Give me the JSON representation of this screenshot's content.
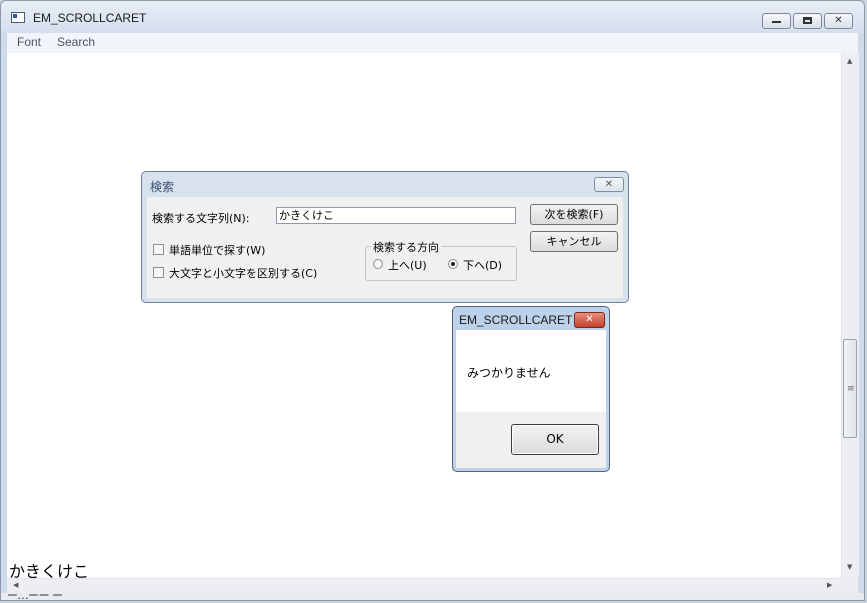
{
  "window": {
    "title": "EM_SCROLLCARET",
    "minimize_glyph": "",
    "close_glyph": "✕"
  },
  "menu": {
    "items": [
      "Font",
      "Search"
    ]
  },
  "editor": {
    "content": "かきくけこ"
  },
  "status_fragment": "ー…ーー ー",
  "find_dialog": {
    "title": "検索",
    "close_glyph": "✕",
    "find_label": "検索する文字列(N):",
    "find_value": "かきくけこ",
    "find_next": "次を検索(F)",
    "cancel": "キャンセル",
    "whole_word": "単語単位で探す(W)",
    "match_case": "大文字と小文字を区別する(C)",
    "direction_label": "検索する方向",
    "up": "上へ(U)",
    "down": "下へ(D)",
    "direction_selected": "down"
  },
  "message_box": {
    "title": "EM_SCROLLCARET",
    "close_glyph": "✕",
    "text": "みつかりません",
    "ok": "OK"
  },
  "scrollbar": {
    "grip_glyph": "≡"
  }
}
